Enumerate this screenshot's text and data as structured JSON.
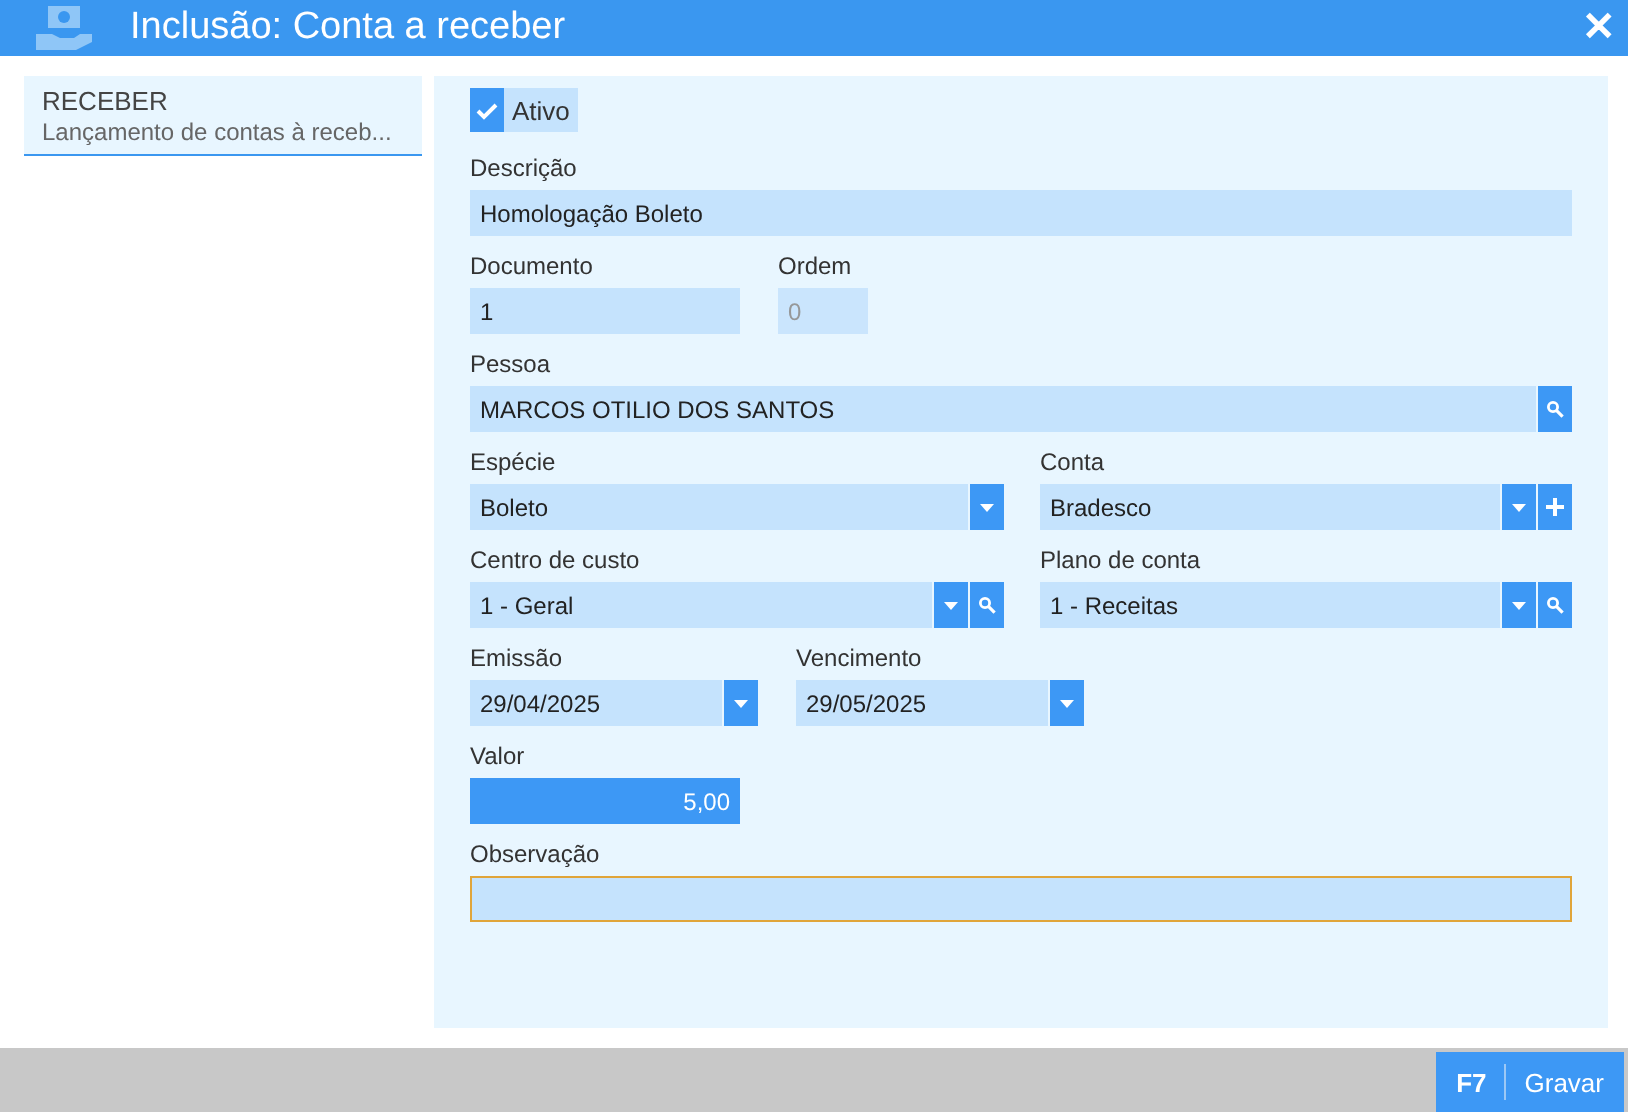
{
  "window": {
    "title": "Inclusão: Conta a receber",
    "close": "✕"
  },
  "sidebar": {
    "items": [
      {
        "title": "RECEBER",
        "subtitle": "Lançamento de contas à receb...",
        "selected": true
      }
    ]
  },
  "form": {
    "active": {
      "label": "Ativo",
      "checked": true
    },
    "rows": [
      [
        {
          "label": "Descrição",
          "value": "Homologação Boleto",
          "kind": "text",
          "disabled": false,
          "selected": false,
          "focused": false,
          "dropdown": false,
          "search": false,
          "add": false
        }
      ],
      [
        {
          "label": "Documento",
          "value": "1",
          "kind": "text",
          "disabled": false,
          "selected": false,
          "focused": false,
          "dropdown": false,
          "search": false,
          "add": false
        },
        {
          "label": "Ordem",
          "value": "0",
          "kind": "text",
          "disabled": true,
          "selected": false,
          "focused": false,
          "dropdown": false,
          "search": false,
          "add": false
        }
      ],
      [
        {
          "label": "Pessoa",
          "value": "MARCOS OTILIO DOS SANTOS",
          "kind": "text",
          "disabled": false,
          "selected": false,
          "focused": false,
          "dropdown": false,
          "search": true,
          "add": false
        }
      ],
      [
        {
          "label": "Espécie",
          "value": "Boleto",
          "kind": "text",
          "disabled": false,
          "selected": false,
          "focused": false,
          "dropdown": true,
          "search": false,
          "add": false
        },
        {
          "label": "Conta",
          "value": "Bradesco",
          "kind": "text",
          "disabled": false,
          "selected": false,
          "focused": false,
          "dropdown": true,
          "search": false,
          "add": true
        }
      ],
      [
        {
          "label": "Centro de custo",
          "value": "1 - Geral",
          "kind": "text",
          "disabled": false,
          "selected": false,
          "focused": false,
          "dropdown": true,
          "search": true,
          "add": false
        },
        {
          "label": "Plano de conta",
          "value": "1 - Receitas",
          "kind": "text",
          "disabled": false,
          "selected": false,
          "focused": false,
          "dropdown": true,
          "search": true,
          "add": false
        }
      ],
      [
        {
          "label": "Emissão",
          "value": "29/04/2025",
          "kind": "text",
          "disabled": false,
          "selected": false,
          "focused": false,
          "dropdown": true,
          "search": false,
          "add": false
        },
        {
          "label": "Vencimento",
          "value": "29/05/2025",
          "kind": "text",
          "disabled": false,
          "selected": false,
          "focused": false,
          "dropdown": true,
          "search": false,
          "add": false
        }
      ],
      [
        {
          "label": "Valor",
          "value": "5,00",
          "kind": "number",
          "disabled": false,
          "selected": true,
          "focused": false,
          "dropdown": false,
          "search": false,
          "add": false
        }
      ],
      [
        {
          "label": "Observação",
          "kind": "text",
          "disabled": false,
          "selected": false,
          "focused": true,
          "dropdown": false,
          "search": false,
          "add": false
        }
      ]
    ]
  },
  "footer": {
    "save_button": {
      "key": "F7",
      "label": "Gravar"
    }
  }
}
